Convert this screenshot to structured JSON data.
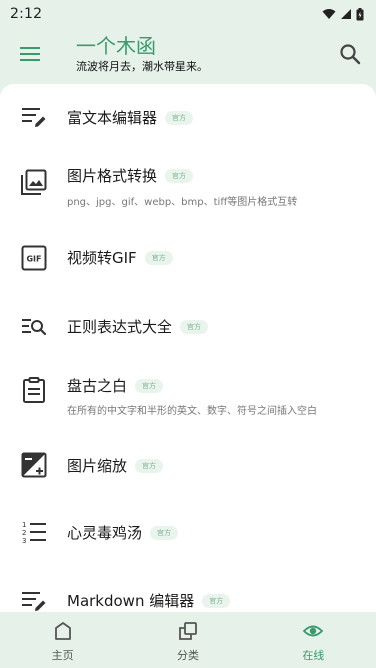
{
  "status_bar": {
    "time": "2:12"
  },
  "header": {
    "title": "一个木函",
    "subtitle": "流波将月去，潮水带星来。"
  },
  "badge_label": "官方",
  "items": [
    {
      "title": "富文本编辑器",
      "subtitle": "",
      "icon": "rich-text-icon"
    },
    {
      "title": "图片格式转换",
      "subtitle": "png、jpg、gif、webp、bmp、tiff等图片格式互转",
      "icon": "image-convert-icon"
    },
    {
      "title": "视频转GIF",
      "subtitle": "",
      "icon": "gif-icon",
      "icon_text": "GIF"
    },
    {
      "title": "正则表达式大全",
      "subtitle": "",
      "icon": "regex-search-icon"
    },
    {
      "title": "盘古之白",
      "subtitle": "在所有的中文字和半形的英文、数字、符号之间插入空白",
      "icon": "clipboard-icon"
    },
    {
      "title": "图片缩放",
      "subtitle": "",
      "icon": "image-resize-icon"
    },
    {
      "title": "心灵毒鸡汤",
      "subtitle": "",
      "icon": "numbered-list-icon"
    },
    {
      "title": "Markdown 编辑器",
      "subtitle": "",
      "icon": "markdown-edit-icon"
    }
  ],
  "bottom_nav": [
    {
      "label": "主页",
      "icon": "home-icon",
      "active": false
    },
    {
      "label": "分类",
      "icon": "category-icon",
      "active": false
    },
    {
      "label": "在线",
      "icon": "eye-icon",
      "active": true
    }
  ],
  "colors": {
    "accent": "#3a9a6c",
    "background": "#e6f1ea",
    "panel": "#ffffff",
    "badge_bg": "#e9f4ed"
  }
}
